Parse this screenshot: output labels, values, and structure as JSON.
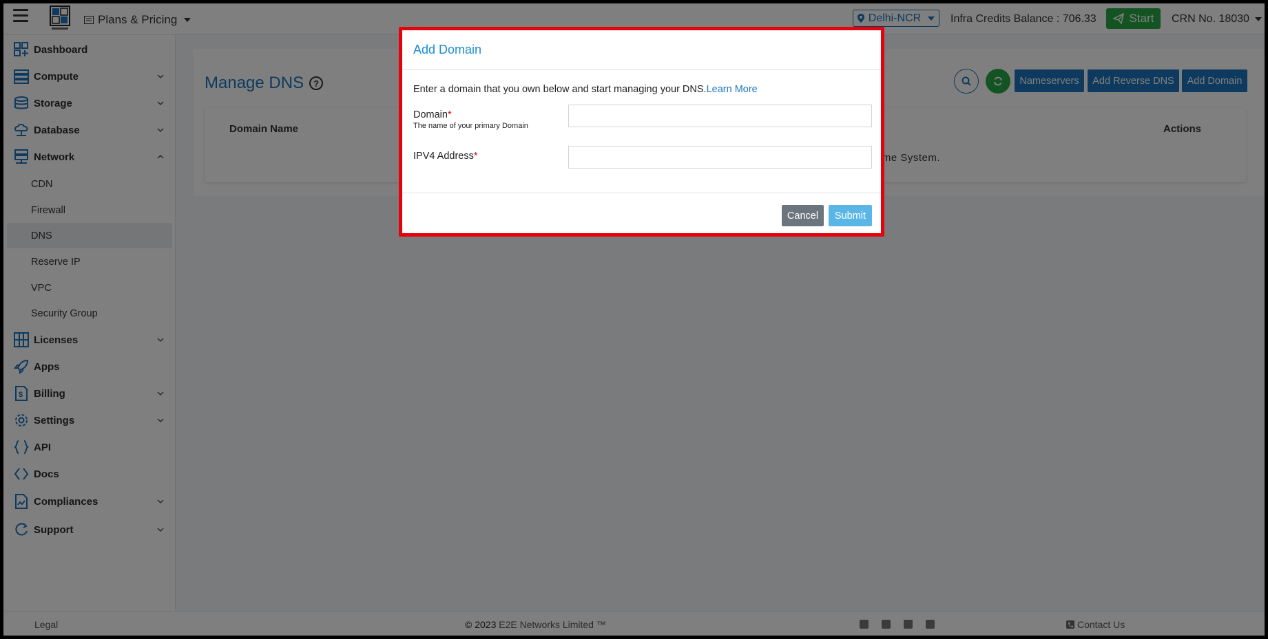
{
  "header": {
    "plans_label": "Plans & Pricing",
    "region": "Delhi-NCR",
    "credits": "Infra Credits Balance : 706.33",
    "start_label": "Start",
    "crn": "CRN No. 18030"
  },
  "sidebar": {
    "items": [
      {
        "label": "Dashboard",
        "icon": "dashboard-icon"
      },
      {
        "label": "Compute",
        "icon": "compute-icon"
      },
      {
        "label": "Storage",
        "icon": "storage-icon"
      },
      {
        "label": "Database",
        "icon": "database-icon"
      },
      {
        "label": "Network",
        "icon": "network-icon"
      },
      {
        "label": "Licenses",
        "icon": "licenses-icon"
      },
      {
        "label": "Apps",
        "icon": "rocket-icon"
      },
      {
        "label": "Billing",
        "icon": "billing-icon"
      },
      {
        "label": "Settings",
        "icon": "gear-icon"
      },
      {
        "label": "API",
        "icon": "braces-icon"
      },
      {
        "label": "Docs",
        "icon": "code-icon"
      },
      {
        "label": "Compliances",
        "icon": "compliances-icon"
      },
      {
        "label": "Support",
        "icon": "support-icon"
      }
    ],
    "network_sub": [
      "CDN",
      "Firewall",
      "DNS",
      "Reserve IP",
      "VPC",
      "Security Group"
    ],
    "active_sub": "DNS"
  },
  "main": {
    "title": "Manage DNS",
    "buttons": {
      "nameservers": "Nameservers",
      "reverse_dns": "Add Reverse DNS",
      "add_domain": "Add Domain"
    },
    "table": {
      "col_domain": "Domain Name",
      "col_actions": "Actions",
      "empty_tail": "ame System."
    }
  },
  "modal": {
    "title": "Add Domain",
    "intro": "Enter a domain that you own below and start managing your DNS.",
    "learn_more": "Learn More",
    "domain_label": "Domain",
    "domain_hint": "The name of your primary Domain",
    "domain_value": "",
    "ipv4_label": "IPV4 Address",
    "ipv4_value": "",
    "required_mark": "*",
    "cancel": "Cancel",
    "submit": "Submit"
  },
  "footer": {
    "legal": "Legal",
    "copyright": "© 2023",
    "company": "E2E Networks Limited ™",
    "contact": "Contact Us"
  },
  "colors": {
    "accent": "#1b75bc",
    "start_green": "#28a745",
    "highlight_red": "#e8000b"
  }
}
